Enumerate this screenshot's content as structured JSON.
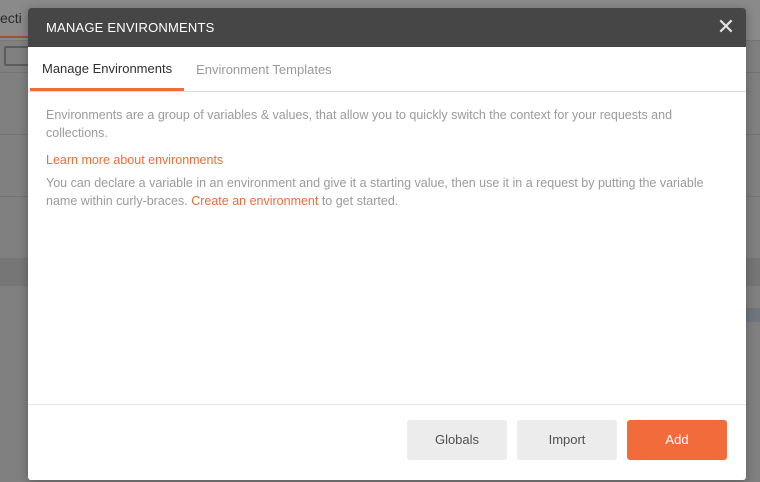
{
  "background": {
    "tab_fragment": "ecti"
  },
  "modal": {
    "title": "MANAGE ENVIRONMENTS",
    "close_glyph": "✕",
    "tabs": [
      {
        "label": "Manage Environments",
        "active": true
      },
      {
        "label": "Environment Templates",
        "active": false
      }
    ],
    "intro": "Environments are a group of variables & values, that allow you to quickly switch the context for your requests and collections.",
    "learn_more": "Learn more about environments",
    "declare_text_before": "You can declare a variable in an environment and give it a starting value, then use it in a request by putting the variable name within curly-braces. ",
    "create_link": "Create an environment",
    "declare_text_after": " to get started.",
    "buttons": {
      "globals": "Globals",
      "import": "Import",
      "add": "Add"
    }
  },
  "colors": {
    "accent": "#f26b3a",
    "header_bg": "#464646"
  }
}
